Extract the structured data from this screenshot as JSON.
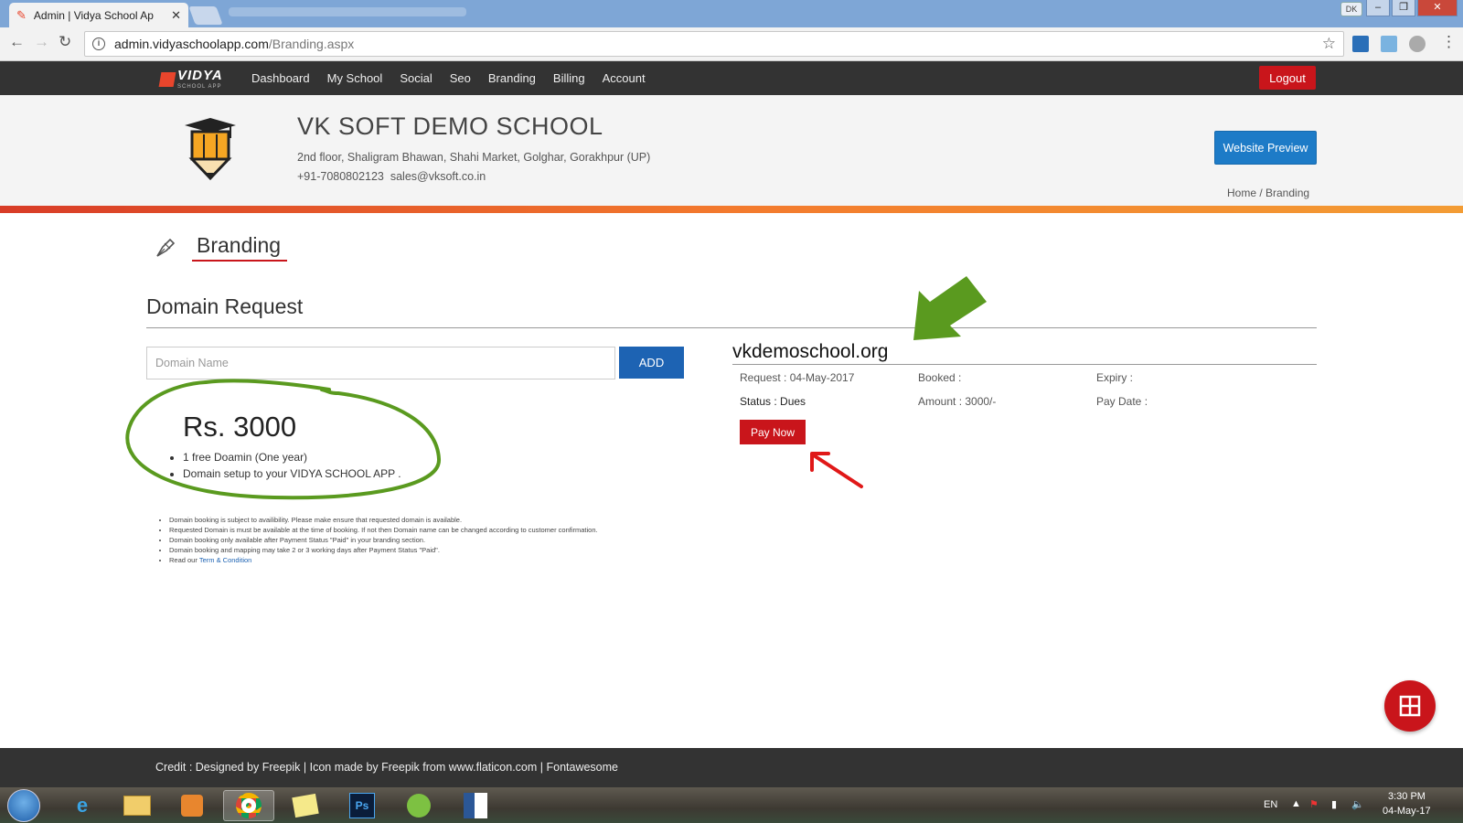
{
  "browser": {
    "tab_title": "Admin | Vidya School Ap",
    "url_host": "admin.vidyaschoolapp.com",
    "url_path": "/Branding.aspx",
    "user_chip": "DK"
  },
  "nav": {
    "logo_text": "VIDYA",
    "logo_sub": "SCHOOL APP",
    "items": [
      "Dashboard",
      "My School",
      "Social",
      "Seo",
      "Branding",
      "Billing",
      "Account"
    ],
    "logout": "Logout"
  },
  "school": {
    "name": "VK SOFT DEMO SCHOOL",
    "address": "2nd floor, Shaligram Bhawan, Shahi Market, Golghar, Gorakhpur (UP)",
    "phone": "+91-7080802123",
    "email": "sales@vksoft.co.in",
    "preview_button": "Website Preview",
    "breadcrumb": "Home / Branding"
  },
  "page": {
    "title": "Branding",
    "section_title": "Domain Request",
    "domain_placeholder": "Domain Name",
    "add_button": "ADD",
    "price": "Rs. 3000",
    "features": [
      "1 free Doamin (One year)",
      "Domain setup to your VIDYA SCHOOL APP ."
    ],
    "notes": [
      "Domain booking is subject to availibility. Please make ensure that requested domain is available.",
      "Requested Domain is must be available at the time of booking. If not then Domain name can be changed according to customer confirmation.",
      "Domain booking only available after Payment Status \"Paid\" in your branding section.",
      "Domain booking and mapping may take 2 or 3 working days after Payment Status \"Paid\"."
    ],
    "terms_prefix": "Read our ",
    "terms_link": "Term & Condition"
  },
  "domain_request": {
    "domain": "vkdemoschool.org",
    "request": "Request : 04-May-2017",
    "booked": "Booked :",
    "expiry": "Expiry :",
    "status": "Status : Dues",
    "amount": "Amount : 3000/-",
    "pay_date": "Pay Date :",
    "pay_button": "Pay Now"
  },
  "footer": {
    "credit": "Credit : Designed by Freepik | Icon made by Freepik from www.flaticon.com | Fontawesome"
  },
  "taskbar": {
    "lang": "EN",
    "time": "3:30 PM",
    "date": "04-May-17",
    "ps_label": "Ps"
  },
  "colors": {
    "accent_red": "#c9151b",
    "accent_blue": "#1d63b3",
    "nav_bg": "#333333",
    "annotation_green": "#5a9a1f"
  }
}
